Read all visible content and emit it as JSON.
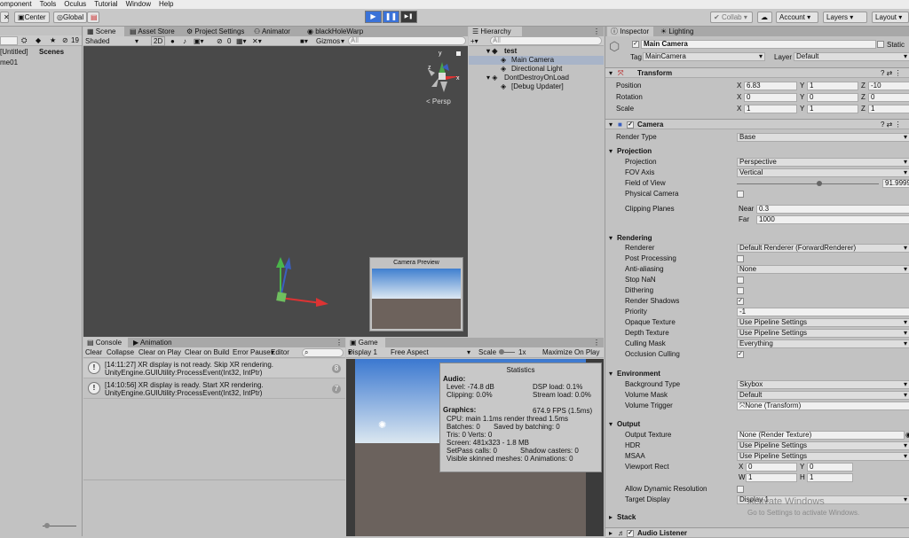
{
  "menu": [
    "omponent",
    "Tools",
    "Oculus",
    "Tutorial",
    "Window",
    "Help"
  ],
  "toolbar": {
    "center": "Center",
    "global": "Global",
    "collab": "Collab",
    "account": "Account",
    "layers": "Layers",
    "layout": "Layout",
    "play": "▶",
    "pause": "❚❚",
    "step": "▶❚"
  },
  "project": {
    "scenes_label": "Scenes",
    "untitled": "[Untitled]",
    "item": "me01",
    "count": "19"
  },
  "scene": {
    "tabs": [
      "Scene",
      "Asset Store",
      "Project Settings",
      "Animator",
      "blackHoleWarp"
    ],
    "shading": "Shaded",
    "mode2d": "2D",
    "gizmos": "Gizmos",
    "search_placeholder": "All",
    "persp": "Persp",
    "camera_preview": "Camera Preview",
    "hidden_count": "0"
  },
  "hierarchy": {
    "tab": "Hierarchy",
    "search_placeholder": "All",
    "items": [
      "test",
      "Main Camera",
      "Directional Light",
      "DontDestroyOnLoad",
      "[Debug Updater]"
    ]
  },
  "inspector": {
    "tabs": [
      "Inspector",
      "Lighting"
    ],
    "object_name": "Main Camera",
    "static_label": "Static",
    "tag_label": "Tag",
    "tag_value": "MainCamera",
    "layer_label": "Layer",
    "layer_value": "Default",
    "transform": {
      "title": "Transform",
      "position": "Position",
      "rotation": "Rotation",
      "scale": "Scale",
      "pos": [
        "6.83",
        "1",
        "-10"
      ],
      "rot": [
        "0",
        "0",
        "0"
      ],
      "scl": [
        "1",
        "1",
        "1"
      ],
      "axes": [
        "X",
        "Y",
        "Z"
      ]
    },
    "camera": {
      "title": "Camera",
      "render_type": "Render Type",
      "render_type_value": "Base",
      "projection": "Projection",
      "projection_label": "Projection",
      "projection_value": "Perspective",
      "fov_axis": "FOV Axis",
      "fov_axis_value": "Vertical",
      "fov": "Field of View",
      "fov_value": "91.9999",
      "fov_fraction": 0.58,
      "physical": "Physical Camera",
      "clipping": "Clipping Planes",
      "near": "Near",
      "near_value": "0.3",
      "far": "Far",
      "far_value": "1000",
      "rendering": "Rendering",
      "renderer": "Renderer",
      "renderer_value": "Default Renderer (ForwardRenderer)",
      "post": "Post Processing",
      "aa": "Anti-aliasing",
      "aa_value": "None",
      "stopnan": "Stop NaN",
      "dither": "Dithering",
      "shadows": "Render Shadows",
      "priority": "Priority",
      "priority_value": "-1",
      "opaque": "Opaque Texture",
      "opaque_value": "Use Pipeline Settings",
      "depth": "Depth Texture",
      "depth_value": "Use Pipeline Settings",
      "culling": "Culling Mask",
      "culling_value": "Everything",
      "occlusion": "Occlusion Culling",
      "environment": "Environment",
      "bgtype": "Background Type",
      "bgtype_value": "Skybox",
      "volmask": "Volume Mask",
      "volmask_value": "Default",
      "voltrig": "Volume Trigger",
      "voltrig_value": "None (Transform)",
      "output": "Output",
      "outtex": "Output Texture",
      "outtex_value": "None (Render Texture)",
      "hdr": "HDR",
      "hdr_value": "Use Pipeline Settings",
      "msaa": "MSAA",
      "msaa_value": "Use Pipeline Settings",
      "viewport": "Viewport Rect",
      "vp": [
        "0",
        "0",
        "1",
        "1"
      ],
      "vp_axes": [
        "X",
        "Y",
        "W",
        "H"
      ],
      "dynres": "Allow Dynamic Resolution",
      "target": "Target Display",
      "target_value": "Display 1",
      "stack": "Stack"
    },
    "audio": "Audio Listener",
    "watermark1": "Activate Windows",
    "watermark2": "Go to Settings to activate Windows."
  },
  "console": {
    "tabs": [
      "Console",
      "Animation"
    ],
    "buttons": [
      "Clear",
      "Collapse",
      "Clear on Play",
      "Clear on Build",
      "Error Pause",
      "Editor"
    ],
    "entries": [
      {
        "line1": "[14:11:27] XR display is not ready. Skip XR rendering.",
        "line2": "UnityEngine.GUIUtility:ProcessEvent(Int32, IntPtr)",
        "count": "8"
      },
      {
        "line1": "[14:10:56] XR display is ready. Start XR rendering.",
        "line2": "UnityEngine.GUIUtility:ProcessEvent(Int32, IntPtr)",
        "count": "7"
      }
    ]
  },
  "game": {
    "tab": "Game",
    "display": "Display 1",
    "aspect": "Free Aspect",
    "scale_label": "Scale",
    "scale_value": "1x",
    "maximize": "Maximize On Play",
    "stats": {
      "title": "Statistics",
      "audio": "Audio:",
      "level": "Level: -74.8 dB",
      "clipping": "Clipping: 0.0%",
      "dsp": "DSP load: 0.1%",
      "stream": "Stream load: 0.0%",
      "graphics": "Graphics:",
      "fps": "674.9 FPS (1.5ms)",
      "cpu": "CPU: main 1.1ms  render thread 1.5ms",
      "batches": "Batches: 0",
      "saved": "Saved by batching: 0",
      "tris": "Tris: 0   Verts: 0",
      "screen": "Screen: 481x323 - 1.8 MB",
      "setpass": "SetPass calls: 0",
      "shadowcasters": "Shadow casters: 0",
      "skinned": "Visible skinned meshes: 0   Animations: 0"
    }
  },
  "colors": {
    "accent": "#3a72d8",
    "selection": "#8fa9d6",
    "scene_bg": "#494949"
  }
}
